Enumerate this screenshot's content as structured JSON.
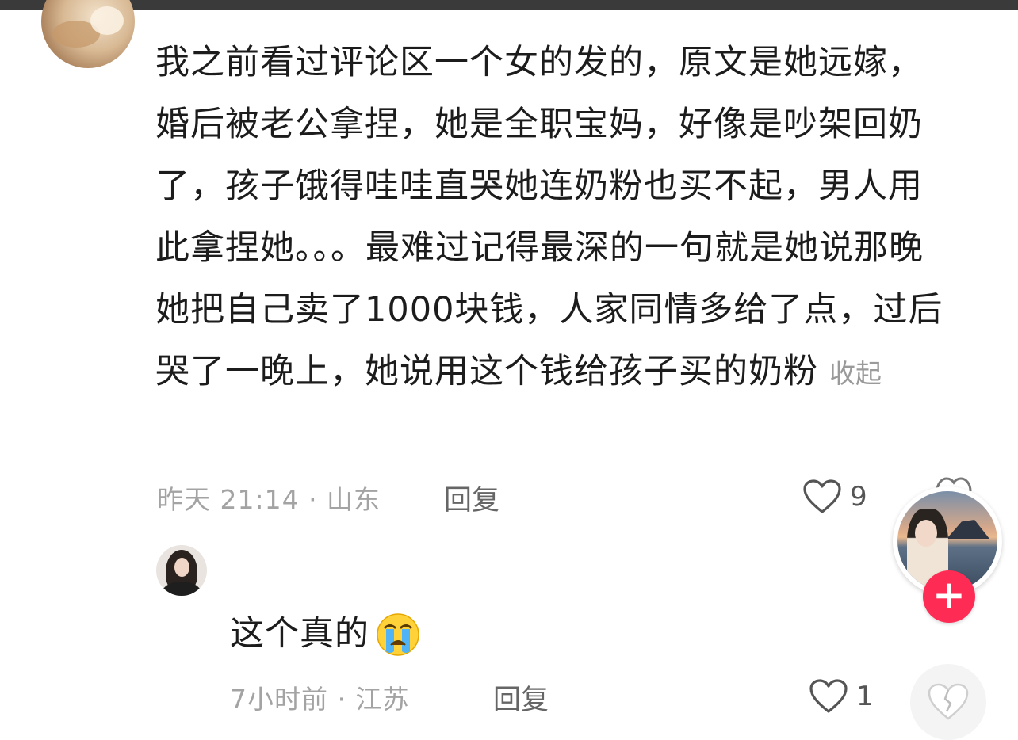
{
  "comment": {
    "text": "我之前看过评论区一个女的发的，原文是她远嫁，婚后被老公拿捏，她是全职宝妈，好像是吵架回奶了，孩子饿得哇哇直哭她连奶粉也买不起，男人用此拿捏她。。。最难过记得最深的一句就是她说那晚她把自己卖了1000块钱，人家同情多给了点，过后哭了一晚上，她说用这个钱给孩子买的奶粉",
    "collapse_label": "收起",
    "meta": "昨天 21:14 · 山东",
    "reply_label": "回复",
    "like_count": "9",
    "avatar_icon": "user-avatar"
  },
  "reply": {
    "text": "这个真的",
    "emoji": "crying-face-emoji",
    "meta": "7小时前 · 江苏",
    "reply_label": "回复",
    "like_count": "1",
    "avatar_icon": "user-avatar"
  },
  "side": {
    "author_avatar_icon": "author-avatar",
    "follow_icon": "plus-icon",
    "follow_symbol": "+",
    "dislike_icon": "broken-heart-icon"
  },
  "colors": {
    "accent": "#fe2c55",
    "text": "#1c1c1c",
    "meta": "#a3a3a3",
    "background": "#ffffff"
  }
}
